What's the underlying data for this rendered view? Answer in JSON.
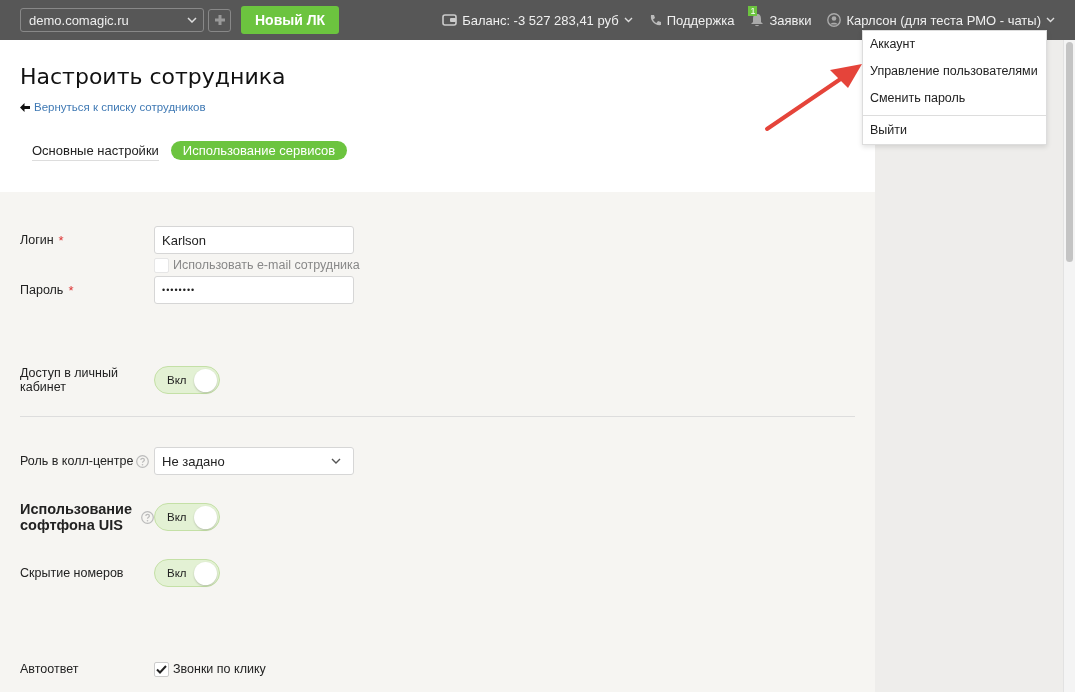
{
  "topbar": {
    "site_select": {
      "value": "demo.comagic.ru"
    },
    "new_button": "Новый ЛК",
    "balance": "Баланс: -3 527 283,41 руб",
    "support": "Поддержка",
    "requests": {
      "label": "Заявки",
      "badge": "1"
    },
    "user": "Карлсон (для теста РМО - чаты)"
  },
  "user_menu": {
    "open": true,
    "items": [
      {
        "label": "Аккаунт",
        "separator_before": false
      },
      {
        "label": "Управление пользователями",
        "separator_before": false
      },
      {
        "label": "Сменить пароль",
        "separator_before": false
      },
      {
        "label": "Выйти",
        "separator_before": true
      }
    ]
  },
  "page": {
    "title": "Настроить сотрудника",
    "back_link": "Вернуться к списку сотрудников"
  },
  "tabs": [
    {
      "label": "Основные настройки",
      "selected": false
    },
    {
      "label": "Использование сервисов",
      "selected": true
    }
  ],
  "sections": [
    {
      "rows": [
        {
          "kind": "input",
          "label": "Логин",
          "required_mark": "*",
          "value": "Karlson"
        },
        {
          "kind": "checkbox",
          "label": "Использовать e-mail сотрудника",
          "checked": false,
          "disabled": true
        },
        {
          "kind": "password",
          "label": "Пароль",
          "required_mark": "*",
          "value": "••••••••"
        },
        {
          "kind": "toggle",
          "label": "Доступ в личный кабинет",
          "on": true,
          "text": "Вкл"
        }
      ]
    },
    {
      "rows": [
        {
          "kind": "select",
          "label": "Роль в колл-центре",
          "help": true,
          "value": "Не задано"
        },
        {
          "kind": "toggle",
          "label": "Использование софтфона UIS",
          "help": true,
          "bold": true,
          "on": true,
          "text": "Вкл"
        },
        {
          "kind": "toggle",
          "label": "Скрытие номеров",
          "on": true,
          "text": "Вкл"
        },
        {
          "kind": "labeled-checkbox",
          "label": "Автоответ",
          "option": "Звонки по клику",
          "checked": true,
          "disabled": false
        }
      ]
    }
  ]
}
